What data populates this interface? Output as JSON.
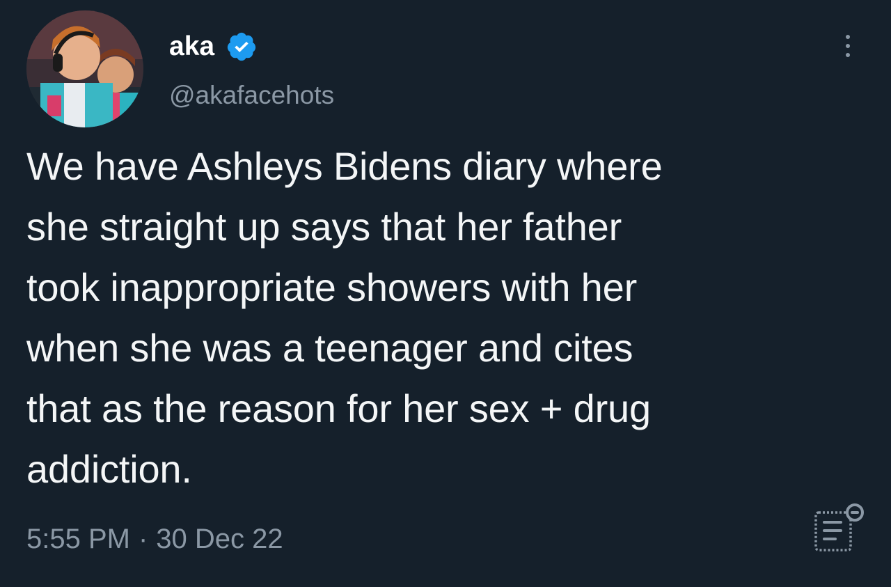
{
  "author": {
    "display_name": "aka",
    "handle": "@akafacehots",
    "verified": true,
    "avatar_icon": "profile-photo"
  },
  "tweet": {
    "lines": [
      "We have Ashleys Bidens diary where",
      "she straight up says that her father",
      "took inappropriate showers with her",
      "when she was a teenager and cites",
      "that as the reason for her sex + drug",
      "addiction."
    ],
    "time": "5:55 PM",
    "separator": "·",
    "date": "30 Dec 22"
  },
  "icons": {
    "verified": "verified-badge-icon",
    "more": "more-options-icon",
    "analytics": "view-analytics-icon"
  },
  "colors": {
    "background": "#15202b",
    "text": "#f4f6f7",
    "secondary_text": "#8b98a5",
    "verified_blue": "#1d9bf0"
  }
}
